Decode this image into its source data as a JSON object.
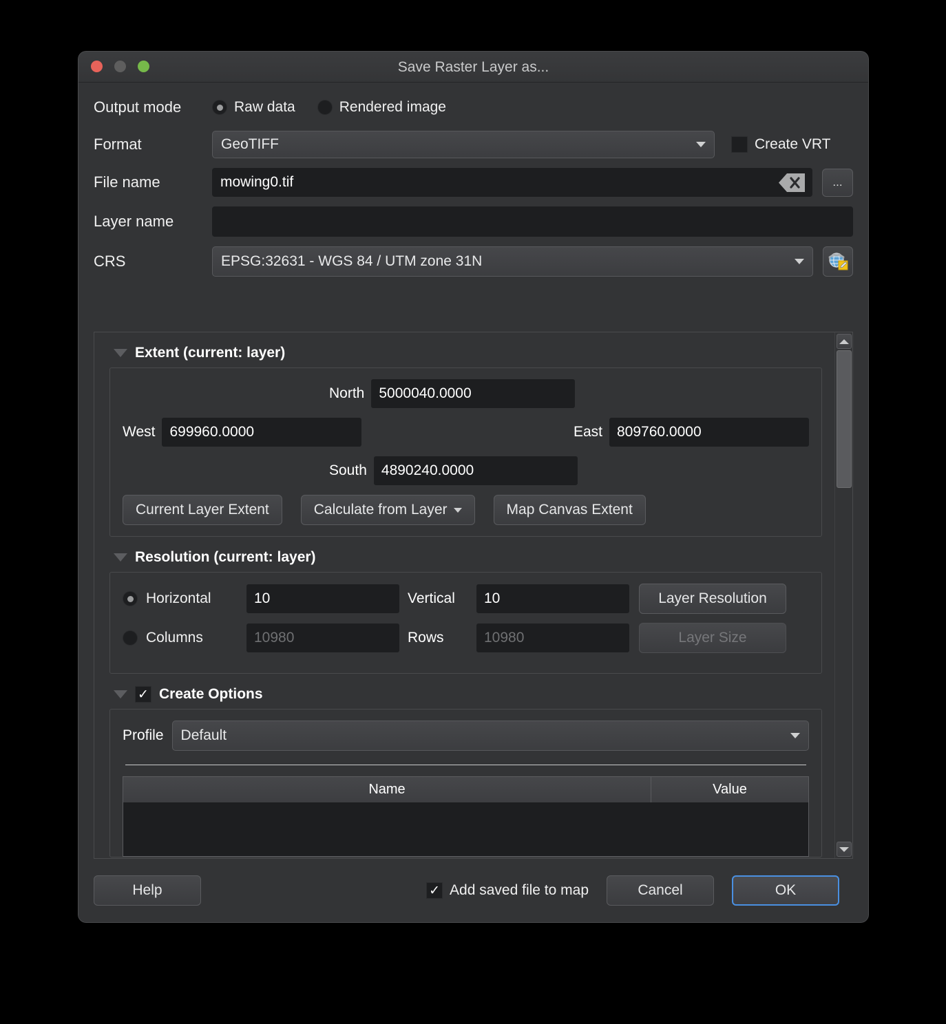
{
  "window": {
    "title": "Save Raster Layer as...",
    "traffic_lights": [
      "close",
      "minimize",
      "zoom"
    ],
    "colors": {
      "close": "#e8635a",
      "minimize": "#5e5e5e",
      "zoom": "#76b94a",
      "accent": "#4a90e2"
    }
  },
  "form": {
    "output_mode_label": "Output mode",
    "output_modes": [
      {
        "label": "Raw data",
        "selected": true
      },
      {
        "label": "Rendered image",
        "selected": false
      }
    ],
    "format_label": "Format",
    "format_value": "GeoTIFF",
    "create_vrt_label": "Create VRT",
    "create_vrt_checked": false,
    "file_name_label": "File name",
    "file_name_value": "mowing0.tif",
    "browse_label": "...",
    "layer_name_label": "Layer name",
    "layer_name_value": "",
    "crs_label": "CRS",
    "crs_value": "EPSG:32631 - WGS 84 / UTM zone 31N"
  },
  "extent": {
    "title": "Extent (current: layer)",
    "north_label": "North",
    "north_value": "5000040.0000",
    "west_label": "West",
    "west_value": "699960.0000",
    "east_label": "East",
    "east_value": "809760.0000",
    "south_label": "South",
    "south_value": "4890240.0000",
    "buttons": {
      "current_layer_extent": "Current Layer Extent",
      "calculate_from_layer": "Calculate from Layer",
      "map_canvas_extent": "Map Canvas Extent"
    }
  },
  "resolution": {
    "title": "Resolution (current: layer)",
    "horizontal_label": "Horizontal",
    "horizontal_value": "10",
    "horizontal_selected": true,
    "vertical_label": "Vertical",
    "vertical_value": "10",
    "columns_label": "Columns",
    "columns_value": "10980",
    "columns_selected": false,
    "rows_label": "Rows",
    "rows_value": "10980",
    "layer_resolution_button": "Layer Resolution",
    "layer_size_button": "Layer Size",
    "layer_size_disabled": true
  },
  "create_options": {
    "title": "Create Options",
    "checked": true,
    "profile_label": "Profile",
    "profile_value": "Default",
    "table": {
      "columns": [
        "Name",
        "Value"
      ],
      "rows": []
    }
  },
  "footer": {
    "help_label": "Help",
    "add_saved_label": "Add saved file to map",
    "add_saved_checked": true,
    "cancel_label": "Cancel",
    "ok_label": "OK"
  }
}
